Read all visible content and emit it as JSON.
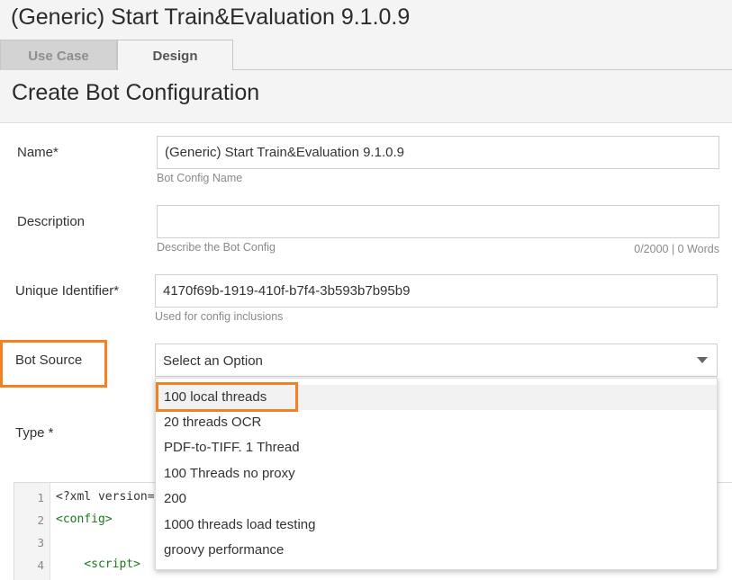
{
  "window": {
    "title": "(Generic) Start Train&Evaluation 9.1.0.9"
  },
  "tabs": [
    {
      "label": "Use Case",
      "active": false
    },
    {
      "label": "Design",
      "active": true
    }
  ],
  "page": {
    "title": "Create Bot Configuration"
  },
  "form": {
    "name": {
      "label": "Name*",
      "value": "(Generic) Start Train&Evaluation 9.1.0.9",
      "hint": "Bot Config Name"
    },
    "description": {
      "label": "Description",
      "value": "",
      "hint": "Describe the Bot Config",
      "counter": "0/2000 | 0 Words"
    },
    "unique_identifier": {
      "label": "Unique Identifier*",
      "value": "4170f69b-1919-410f-b7f4-3b593b7b95b9",
      "hint": "Used for config inclusions"
    },
    "bot_source": {
      "label": "Bot Source",
      "placeholder": "Select an Option",
      "options": [
        "100 local threads",
        "20 threads OCR",
        "PDF-to-TIFF. 1 Thread",
        "100 Threads no proxy",
        "200",
        "1000 threads load testing",
        "groovy performance"
      ],
      "hovered_option": "100 local threads"
    },
    "type": {
      "label": "Type *"
    }
  },
  "editor": {
    "lines": [
      {
        "number": "1",
        "text": "<?xml version="
      },
      {
        "number": "2",
        "text": "<config>"
      },
      {
        "number": "3",
        "text": ""
      },
      {
        "number": "4",
        "text": "    <script>"
      }
    ]
  },
  "colors": {
    "highlight": "#f08224",
    "tag": "#1a7a1a",
    "page_background": "#f4f4f4"
  }
}
